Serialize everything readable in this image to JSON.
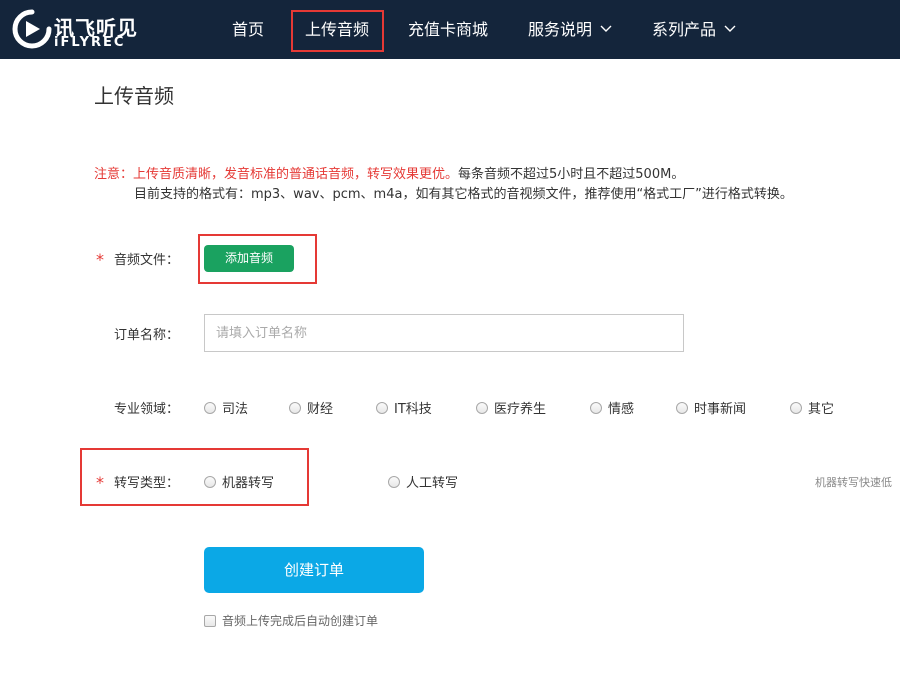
{
  "header": {
    "logo_cn": "讯飞听见",
    "logo_en": "iFLYREC",
    "nav": [
      {
        "label": "首页",
        "has_dropdown": false
      },
      {
        "label": "上传音频",
        "has_dropdown": false,
        "active": true
      },
      {
        "label": "充值卡商城",
        "has_dropdown": false
      },
      {
        "label": "服务说明",
        "has_dropdown": true
      },
      {
        "label": "系列产品",
        "has_dropdown": true
      }
    ],
    "background_color": "#14253b",
    "highlight_color": "#e53935"
  },
  "page": {
    "title": "上传音频",
    "notice_red": "注意：上传音质清晰，发音标准的普通话音频，转写效果更优。",
    "notice_dark": "每条音频不超过5小时且不超过500M。",
    "notice_line2": "目前支持的格式有：mp3、wav、pcm、m4a，如有其它格式的音视频文件，推荐使用“格式工厂”进行格式转换。"
  },
  "form": {
    "required_mark": "*",
    "audio_file": {
      "label": "音频文件：",
      "button_label": "添加音频",
      "button_color": "#1aa260"
    },
    "order_name": {
      "label": "订单名称：",
      "placeholder": "请填入订单名称",
      "value": ""
    },
    "domain": {
      "label": "专业领域：",
      "options": [
        "司法",
        "财经",
        "IT科技",
        "医疗养生",
        "情感",
        "时事新闻",
        "其它"
      ]
    },
    "transcribe_type": {
      "label": "转写类型：",
      "options": [
        "机器转写",
        "人工转写"
      ],
      "hint": "机器转写快速低"
    },
    "create_button": {
      "label": "创建订单",
      "color": "#0ba8e6"
    },
    "auto_create": {
      "label": "音频上传完成后自动创建订单",
      "checked": false
    }
  }
}
